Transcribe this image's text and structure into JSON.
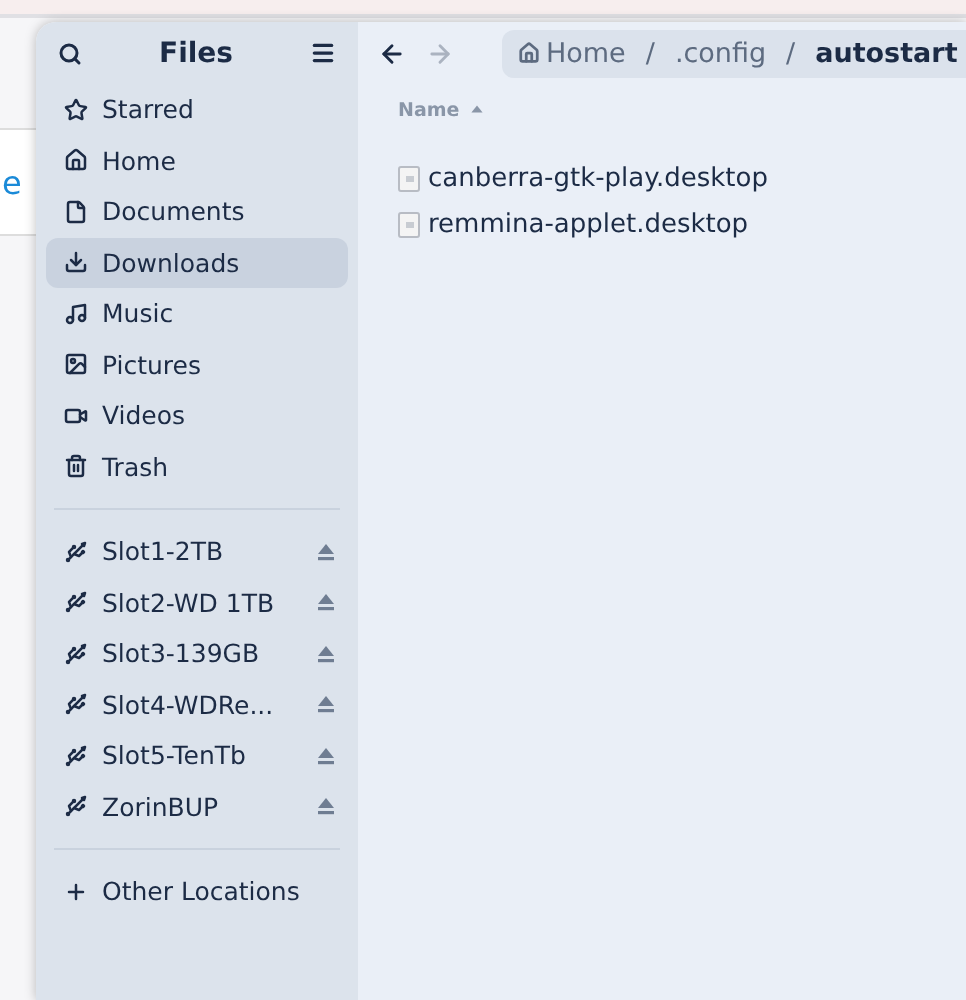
{
  "background": {
    "text": "e"
  },
  "sidebar": {
    "title": "Files",
    "places": [
      {
        "label": "Starred",
        "kind": "starred",
        "selected": false
      },
      {
        "label": "Home",
        "kind": "home",
        "selected": false
      },
      {
        "label": "Documents",
        "kind": "documents",
        "selected": false
      },
      {
        "label": "Downloads",
        "kind": "downloads",
        "selected": true
      },
      {
        "label": "Music",
        "kind": "music",
        "selected": false
      },
      {
        "label": "Pictures",
        "kind": "pictures",
        "selected": false
      },
      {
        "label": "Videos",
        "kind": "videos",
        "selected": false
      },
      {
        "label": "Trash",
        "kind": "trash",
        "selected": false
      }
    ],
    "devices": [
      {
        "label": "Slot1-2TB",
        "selected": false
      },
      {
        "label": "Slot2-WD 1TB",
        "selected": false
      },
      {
        "label": "Slot3-139GB",
        "selected": false
      },
      {
        "label": "Slot4-WDRe...",
        "selected": false
      },
      {
        "label": "Slot5-TenTb",
        "selected": false
      },
      {
        "label": "ZorinBUP",
        "selected": false
      }
    ],
    "other": {
      "label": "Other Locations",
      "selected": false
    }
  },
  "toolbar": {
    "back_disabled": false,
    "forward_disabled": true,
    "separator": "/",
    "breadcrumb": [
      {
        "label": "Home",
        "kind": "home",
        "selected": false
      },
      {
        "label": ".config",
        "kind": "folder",
        "selected": false
      },
      {
        "label": "autostart",
        "kind": "folder",
        "selected": true
      }
    ]
  },
  "table": {
    "columns": [
      {
        "label": "Name"
      }
    ],
    "rows": [
      {
        "name": "canberra-gtk-play.desktop",
        "selected": false
      },
      {
        "name": "remmina-applet.desktop",
        "selected": false
      }
    ]
  }
}
